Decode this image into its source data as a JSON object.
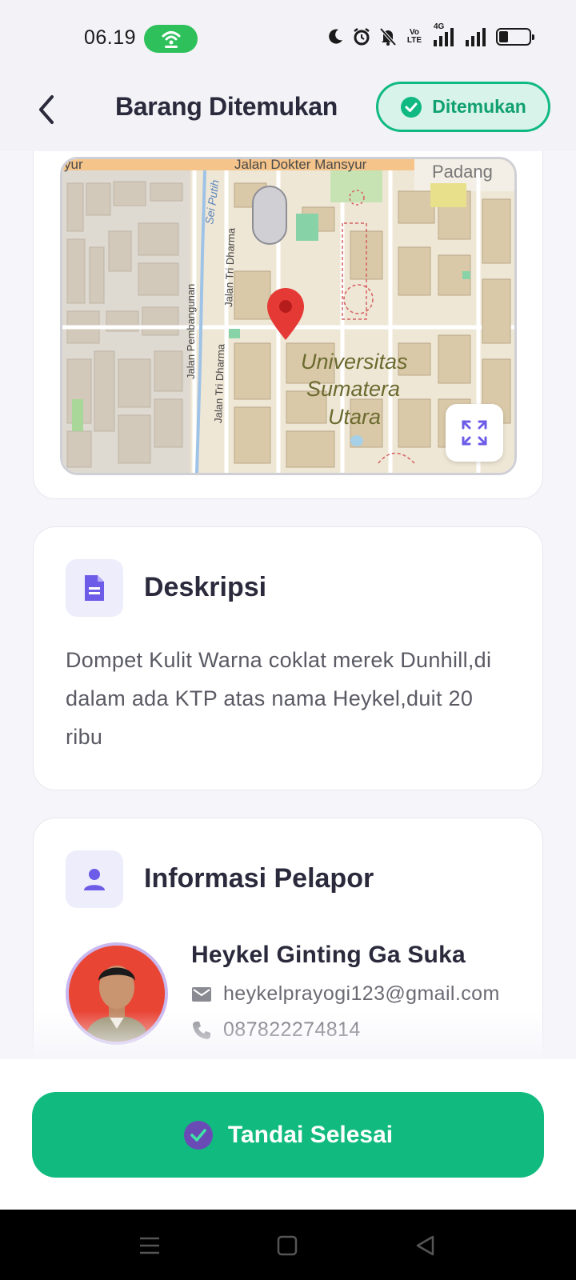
{
  "status_bar": {
    "time": "06.19",
    "icons": [
      "hotspot-icon",
      "moon-icon",
      "alarm-icon",
      "bell-off-icon",
      "volte-icon",
      "signal-4g-icon",
      "signal-icon",
      "battery-icon"
    ],
    "volte_label": "Vo LTE",
    "network_label": "4G",
    "battery_level": 0.3
  },
  "header": {
    "title": "Barang Ditemukan",
    "status_chip": "Ditemukan"
  },
  "map": {
    "labels": {
      "street_top": "Jalan Dokter Mansyur",
      "street_top_left": "yur",
      "area_top_right": "Padang",
      "river": "Sei Putih",
      "street_tri_dharma_upper": "Jalan Tri Dharma",
      "street_pembangunan": "Jalan Pembangunan",
      "street_tri_dharma_lower": "Jalan Tri Dharma",
      "campus_line1": "Universitas",
      "campus_line2": "Sumatera",
      "campus_line3": "Utara"
    }
  },
  "description": {
    "title": "Deskripsi",
    "text": "Dompet Kulit Warna coklat merek Dunhill,di dalam ada KTP atas nama Heykel,duit 20 ribu"
  },
  "reporter": {
    "title": "Informasi Pelapor",
    "name": "Heykel Ginting Ga Suka",
    "email": "heykelprayogi123@gmail.com",
    "phone": "087822274814"
  },
  "action": {
    "label": "Tandai Selesai"
  },
  "colors": {
    "accent_green": "#11bb7f",
    "chip_border": "#10b981",
    "icon_purple": "#6c5ce7",
    "marker_red": "#e53935"
  }
}
